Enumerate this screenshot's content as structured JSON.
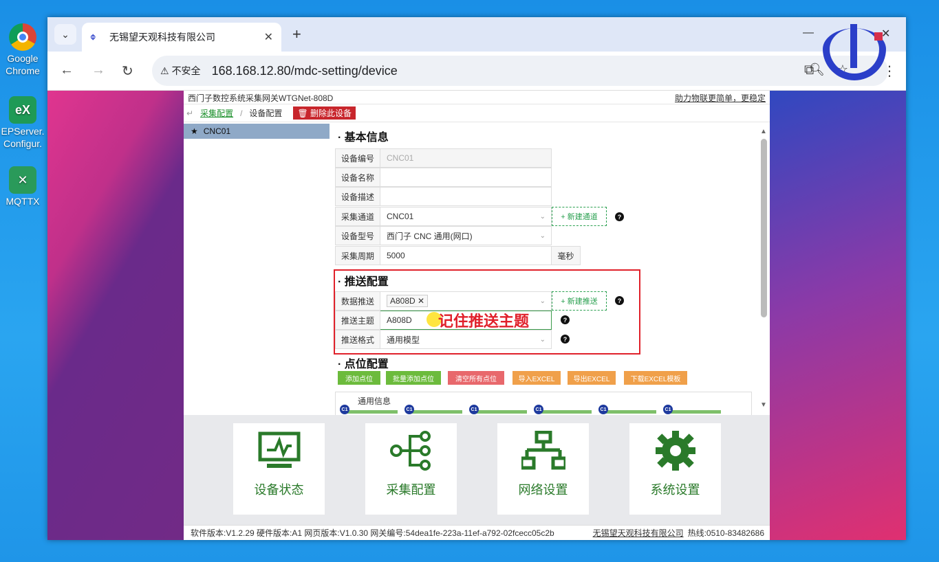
{
  "desktop": {
    "icons": [
      {
        "label_1": "Google",
        "label_2": "Chrome"
      },
      {
        "label_1": "EPServer.",
        "label_2": "Configur."
      },
      {
        "label_1": "MQTTX",
        "label_2": ""
      }
    ]
  },
  "browser": {
    "tab_title": "无锡望天观科技有限公司",
    "new_tab": "+",
    "security_label": "不安全",
    "url": "168.168.12.80/mdc-setting/device"
  },
  "app": {
    "header_left": "西门子数控系统采集网关WTGNet-808D",
    "header_right": "助力物联更简单，更稳定",
    "breadcrumb_link": "采集配置",
    "breadcrumb_sep": "/",
    "breadcrumb_current": "设备配置",
    "delete_button": "删除此设备",
    "sidebar_items": [
      "CNC01"
    ],
    "basic": {
      "title": "· 基本信息",
      "device_id_label": "设备编号",
      "device_id_value": "CNC01",
      "device_name_label": "设备名称",
      "device_name_value": "",
      "device_desc_label": "设备描述",
      "device_desc_value": "",
      "channel_label": "采集通道",
      "channel_value": "CNC01",
      "new_channel": "+ 新建通道",
      "model_label": "设备型号",
      "model_value": "西门子 CNC 通用(网口)",
      "period_label": "采集周期",
      "period_value": "5000",
      "period_unit": "毫秒"
    },
    "push": {
      "title": "· 推送配置",
      "data_push_label": "数据推送",
      "data_push_tag": "A808D",
      "new_push": "+ 新建推送",
      "topic_label": "推送主题",
      "topic_value": "A808D",
      "format_label": "推送格式",
      "format_value": "通用模型",
      "annotation": "记住推送主题"
    },
    "points": {
      "title": "· 点位配置",
      "buttons": [
        {
          "label": "添加点位",
          "color": "#6cbb3c"
        },
        {
          "label": "批量添加点位",
          "color": "#6cbb3c"
        },
        {
          "label": "清空所有点位",
          "color": "#e8686c"
        },
        {
          "label": "导入EXCEL",
          "color": "#f0a04a"
        },
        {
          "label": "导出EXCEL",
          "color": "#f0a04a"
        },
        {
          "label": "下载EXCEL模板",
          "color": "#f0a04a"
        }
      ],
      "tab_label": "通用信息",
      "badge": "C1"
    },
    "tiles": [
      {
        "label": "设备状态",
        "icon": "monitor-pulse-icon"
      },
      {
        "label": "采集配置",
        "icon": "tree-nodes-icon"
      },
      {
        "label": "网络设置",
        "icon": "network-icon"
      },
      {
        "label": "系统设置",
        "icon": "gear-icon"
      }
    ],
    "footer": {
      "info": "软件版本:V1.2.29  硬件版本:A1  网页版本:V1.0.30  网关编号:54dea1fe-223a-11ef-a792-02fcecc05c2b",
      "company": "无锡望天观科技有限公司",
      "hotline": "热线:0510-83482686"
    },
    "colors": {
      "accent_green": "#2a7a2a",
      "danger": "#c8262c",
      "highlight": "#e0202a"
    }
  }
}
